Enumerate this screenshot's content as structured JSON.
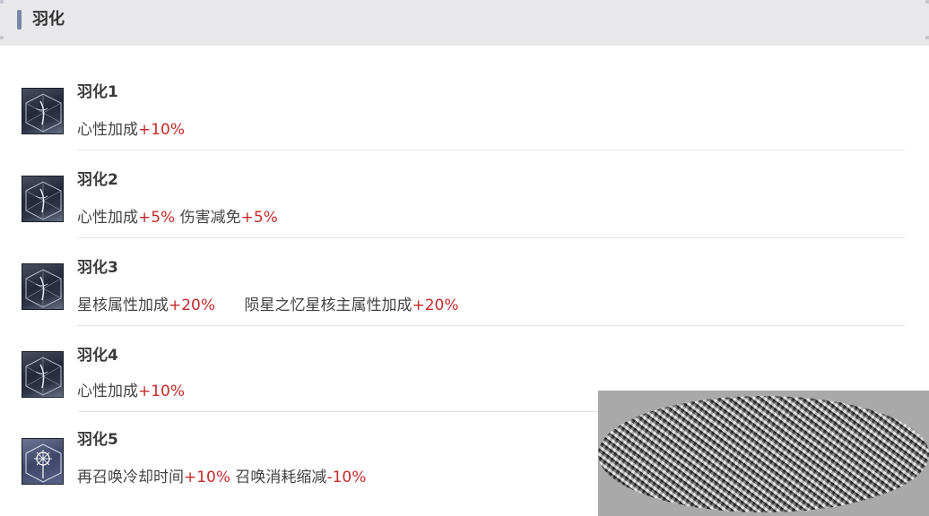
{
  "header": {
    "title": "羽化"
  },
  "items": [
    {
      "name": "羽化1",
      "effects": [
        {
          "text": "心性加成",
          "value": "+10%"
        }
      ]
    },
    {
      "name": "羽化2",
      "effects": [
        {
          "text": "心性加成",
          "value": "+5%"
        },
        {
          "text": " 伤害减免",
          "value": "+5%"
        }
      ]
    },
    {
      "name": "羽化3",
      "effects": [
        {
          "text": "星核属性加成",
          "value": "+20%"
        },
        {
          "text": "      陨星之忆星核主属性加成",
          "value": "+20%"
        }
      ]
    },
    {
      "name": "羽化4",
      "effects": [
        {
          "text": "心性加成",
          "value": "+10%"
        }
      ]
    },
    {
      "name": "羽化5",
      "effects": [
        {
          "text": "再召唤冷却时间",
          "value": "+10%"
        },
        {
          "text": " 召唤消耗缩减",
          "value": "-10%"
        }
      ]
    }
  ],
  "icons": [
    "feather-cube-icon",
    "feather-cube-icon",
    "feather-cube-icon",
    "feather-cube-icon",
    "flower-cube-icon"
  ],
  "colors": {
    "accent_bar": "#7a86a6",
    "value_red": "#c62a2a",
    "header_bg": "#e8e8ea"
  }
}
